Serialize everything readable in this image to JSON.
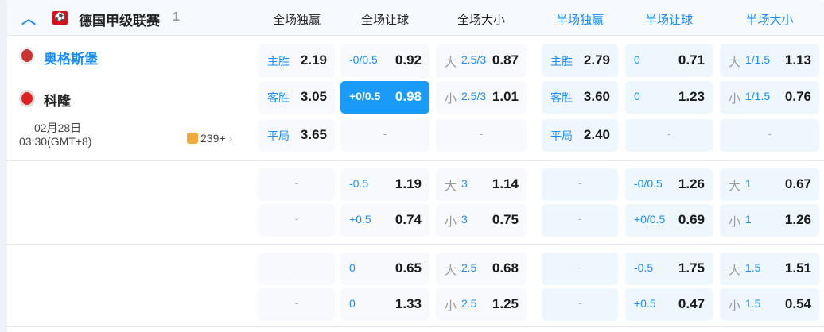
{
  "league": {
    "name": "德国甲级联赛",
    "count": "1",
    "flag_color": "#d8121b"
  },
  "columns": [
    "全场独赢",
    "全场让球",
    "全场大小",
    "半场独赢",
    "半场让球",
    "半场大小"
  ],
  "match": {
    "home": "奥格斯堡",
    "away": "科隆",
    "date": "02月28日",
    "time": "03:30(GMT+8)",
    "more": "239+"
  },
  "blocks": [
    [
      [
        {
          "pre": "",
          "ln": "主胜",
          "od": "2.19"
        },
        {
          "pre": "",
          "ln": "-0/0.5",
          "od": "0.92"
        },
        {
          "pre": "大",
          "ln": "2.5/3",
          "od": "0.87"
        },
        {
          "pre": "",
          "ln": "主胜",
          "od": "2.79"
        },
        {
          "pre": "",
          "ln": "0",
          "od": "0.71"
        },
        {
          "pre": "大",
          "ln": "1/1.5",
          "od": "1.13"
        }
      ],
      [
        {
          "pre": "",
          "ln": "客胜",
          "od": "3.05"
        },
        {
          "pre": "",
          "ln": "+0/0.5",
          "od": "0.98",
          "selected": true
        },
        {
          "pre": "小",
          "ln": "2.5/3",
          "od": "1.01"
        },
        {
          "pre": "",
          "ln": "客胜",
          "od": "3.60"
        },
        {
          "pre": "",
          "ln": "0",
          "od": "1.23"
        },
        {
          "pre": "小",
          "ln": "1/1.5",
          "od": "0.76"
        }
      ],
      [
        {
          "pre": "",
          "ln": "平局",
          "od": "3.65"
        },
        null,
        null,
        {
          "pre": "",
          "ln": "平局",
          "od": "2.40"
        },
        null,
        null
      ]
    ],
    [
      [
        null,
        {
          "pre": "",
          "ln": "-0.5",
          "od": "1.19"
        },
        {
          "pre": "大",
          "ln": "3",
          "od": "1.14"
        },
        null,
        {
          "pre": "",
          "ln": "-0/0.5",
          "od": "1.26"
        },
        {
          "pre": "大",
          "ln": "1",
          "od": "0.67"
        }
      ],
      [
        null,
        {
          "pre": "",
          "ln": "+0.5",
          "od": "0.74"
        },
        {
          "pre": "小",
          "ln": "3",
          "od": "0.75"
        },
        null,
        {
          "pre": "",
          "ln": "+0/0.5",
          "od": "0.69"
        },
        {
          "pre": "小",
          "ln": "1",
          "od": "1.26"
        }
      ]
    ],
    [
      [
        null,
        {
          "pre": "",
          "ln": "0",
          "od": "0.65"
        },
        {
          "pre": "大",
          "ln": "2.5",
          "od": "0.68"
        },
        null,
        {
          "pre": "",
          "ln": "-0.5",
          "od": "1.75"
        },
        {
          "pre": "大",
          "ln": "1.5",
          "od": "1.51"
        }
      ],
      [
        null,
        {
          "pre": "",
          "ln": "0",
          "od": "1.33"
        },
        {
          "pre": "小",
          "ln": "2.5",
          "od": "1.25"
        },
        null,
        {
          "pre": "",
          "ln": "+0.5",
          "od": "0.47"
        },
        {
          "pre": "小",
          "ln": "1.5",
          "od": "0.54"
        }
      ]
    ]
  ],
  "empty": "-"
}
